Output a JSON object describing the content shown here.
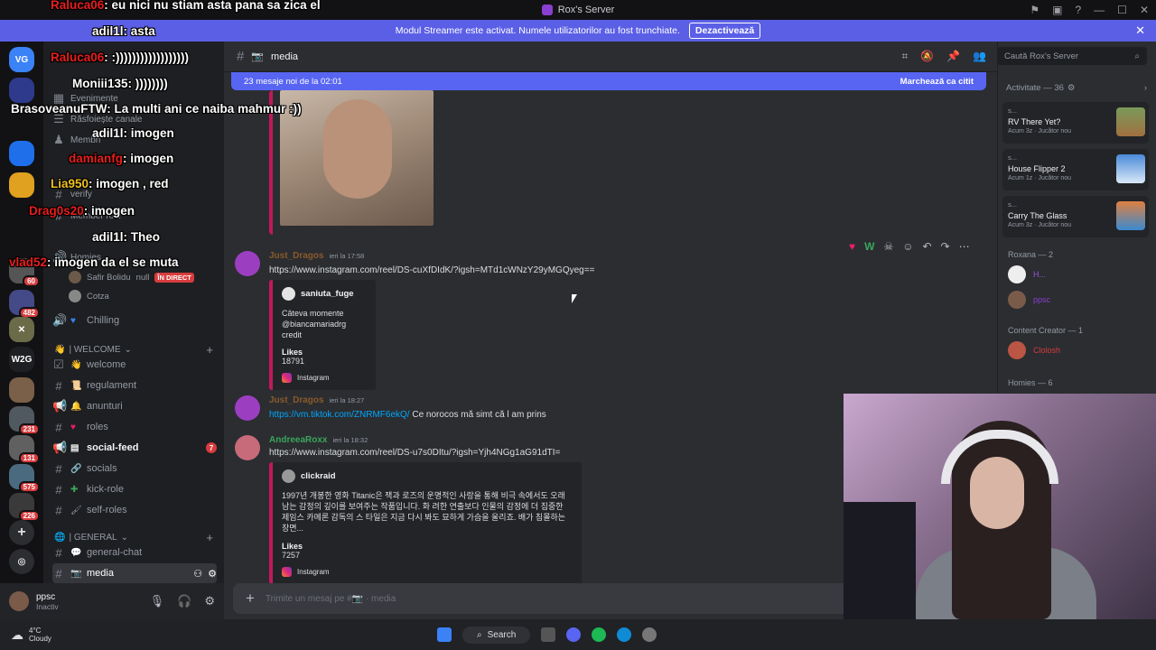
{
  "window": {
    "title": "Rox's Server"
  },
  "banner": {
    "text": "Modul Streamer este activat. Numele utilizatorilor au fost trunchiate.",
    "button": "Dezactivează"
  },
  "guilds": [
    {
      "label": "VG",
      "badge": ""
    },
    {
      "label": "",
      "badge": ""
    },
    {
      "label": "",
      "badge": ""
    },
    {
      "label": "",
      "badge": "60"
    },
    {
      "label": "",
      "badge": "482"
    },
    {
      "label": "",
      "badge": ""
    },
    {
      "label": "W2G",
      "badge": ""
    },
    {
      "label": "",
      "badge": ""
    },
    {
      "label": "",
      "badge": "231"
    },
    {
      "label": "",
      "badge": "131"
    },
    {
      "label": "",
      "badge": ""
    },
    {
      "label": "",
      "badge": "575"
    },
    {
      "label": "",
      "badge": "226"
    }
  ],
  "sidebar": {
    "top_items": [
      "Evenimente",
      "Răsfoiește canale",
      "Membri"
    ],
    "voice_users": [
      {
        "name": "Safir Bolidu",
        "tag": "null",
        "live": "ÎN DIRECT"
      },
      {
        "name": "Cotza",
        "tag": "",
        "live": ""
      }
    ],
    "chilling": "Chilling",
    "welcome_category": "| WELCOME",
    "welcome_channels": [
      "welcome",
      "regulament",
      "anunturi",
      "roles",
      "social-feed",
      "socials",
      "kick-role",
      "self-roles"
    ],
    "social_feed_unread": "7",
    "general_category": "| GENERAL",
    "general_channels": [
      "general-chat",
      "media"
    ],
    "verify": "verify",
    "members_role": "Member role",
    "homies": "Homies"
  },
  "user": {
    "name": "ppsc",
    "status": "Inactiv"
  },
  "header": {
    "channel": "media"
  },
  "new_messages_bar": {
    "text": "23 mesaje noi de la 02:01",
    "mark_read": "Marchează ca citit"
  },
  "messages": [
    {
      "author": "Just_Dragos",
      "time": "ieri la 17:58",
      "author_color": "#8a5a2a",
      "link": "https://www.instagram.com/reel/DS-cuXfDIdK/?igsh=MTd1cWNzY29yMGQyeg==",
      "embed": {
        "author": "saniuta_fuge",
        "desc": "Câteva momente @biancamariadrg credit",
        "field": "Likes",
        "value": "18791",
        "footer": "Instagram"
      }
    },
    {
      "author": "Just_Dragos",
      "time": "ieri la 18:27",
      "author_color": "#8a5a2a",
      "link": "https://vm.tiktok.com/ZNRMF6ekQ/",
      "text": "Ce norocos mă simt că l am prins"
    },
    {
      "author": "AndreeaRoxx",
      "time": "ieri la 18:32",
      "author_color": "#3ba55c",
      "link": "https://www.instagram.com/reel/DS-u7s0DItu/?igsh=Yjh4NGg1aG91dTI=",
      "embed": {
        "author": "clickraid",
        "desc": "1997년 개봉한 영화 Titanic은 잭과 로즈의 운명적인 사랑을 통해 비극 속에서도 오래 남는 감정의 깊이를 보여주는 작품입니다. 화 려한 연출보다 인물의 감정에 더 집중한 제임스 카메론 감독의 스 타일은 지금 다시 봐도 묘하게 가슴을 울리죠. 배가 침몰하는 장면...",
        "field": "Likes",
        "value": "7257",
        "footer": "Instagram"
      }
    }
  ],
  "composer": {
    "placeholder": "Trimite un mesaj pe #📷 · media"
  },
  "search": {
    "placeholder": "Caută Rox's Server"
  },
  "activity": {
    "header": "Activitate — 36",
    "cards": [
      {
        "user": "s...",
        "game": "RV There Yet?",
        "meta": "Acum 3z · Jucător nou"
      },
      {
        "user": "s...",
        "game": "House Flipper 2",
        "meta": "Acum 1z · Jucător nou"
      },
      {
        "user": "s...",
        "game": "Carry The Glass",
        "meta": "Acum 3z · Jucător nou"
      }
    ]
  },
  "member_groups": [
    {
      "title": "Roxana — 2",
      "members": [
        "H...",
        "ppsc"
      ]
    },
    {
      "title": "Content Creator — 1",
      "members": [
        "Clolosh"
      ]
    },
    {
      "title": "Homies — 6",
      "members": []
    }
  ],
  "stream_chat": [
    {
      "nick": "Raluca06",
      "msg": "eu nici nu stiam asta pana sa zica el"
    },
    {
      "nick": "adil1l",
      "msg": "asta"
    },
    {
      "nick": "Raluca06",
      "msg": ":))))))))))))))))))"
    },
    {
      "nick": "Moniii135",
      "msg": "))))))))"
    },
    {
      "nick": "BrasoveanuFTW",
      "msg": "La multi ani ce naiba mahmur :))"
    },
    {
      "nick": "adil1l",
      "msg": "imogen"
    },
    {
      "nick": "damianfg",
      "msg": "imogen"
    },
    {
      "nick": "Lia950",
      "msg": "imogen , red"
    },
    {
      "nick": "Drag0s20",
      "msg": "imogen"
    },
    {
      "nick": "adil1l",
      "msg": "Theo"
    },
    {
      "nick": "vlad52",
      "msg": "imogen da el se muta"
    }
  ],
  "taskbar": {
    "weather_temp": "4°C",
    "weather_desc": "Cloudy",
    "search": "Search"
  }
}
